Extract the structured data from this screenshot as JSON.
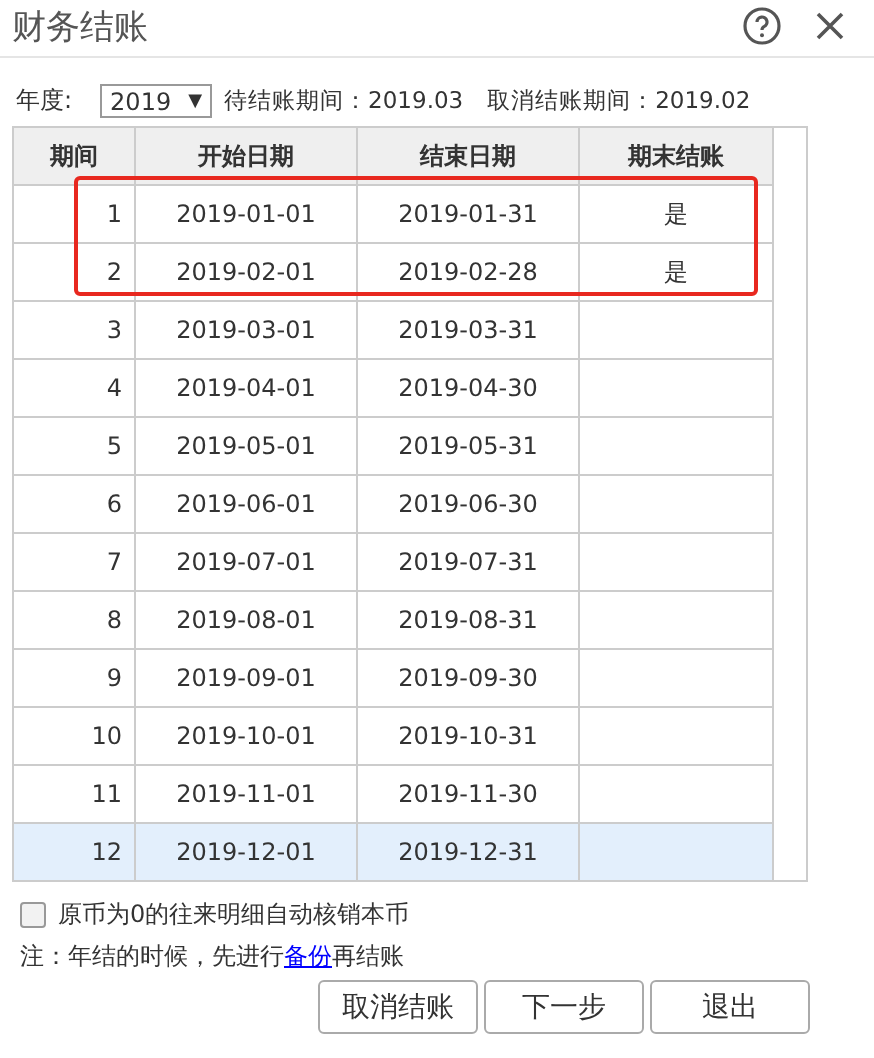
{
  "window": {
    "title": "财务结账"
  },
  "toolbar": {
    "year_label": "年度:",
    "year": "2019",
    "year_caret": "▼",
    "pending_period": "待结账期间：2019.03",
    "cancel_period": "取消结账期间：2019.02"
  },
  "table": {
    "columns": [
      "期间",
      "开始日期",
      "结束日期",
      "期末结账"
    ],
    "rows": [
      {
        "period": "1",
        "start": "2019-01-01",
        "end": "2019-01-31",
        "closed": "是",
        "selected": false,
        "marked": true
      },
      {
        "period": "2",
        "start": "2019-02-01",
        "end": "2019-02-28",
        "closed": "是",
        "selected": false,
        "marked": true
      },
      {
        "period": "3",
        "start": "2019-03-01",
        "end": "2019-03-31",
        "selected": false,
        "marked": false
      },
      {
        "period": "4",
        "start": "2019-04-01",
        "end": "2019-04-30",
        "selected": false,
        "marked": false
      },
      {
        "period": "5",
        "start": "2019-05-01",
        "end": "2019-05-31",
        "selected": false,
        "marked": false
      },
      {
        "period": "6",
        "start": "2019-06-01",
        "end": "2019-06-30",
        "selected": false,
        "marked": false
      },
      {
        "period": "7",
        "start": "2019-07-01",
        "end": "2019-07-31",
        "selected": false,
        "marked": false
      },
      {
        "period": "8",
        "start": "2019-08-01",
        "end": "2019-08-31",
        "selected": false,
        "marked": false
      },
      {
        "period": "9",
        "start": "2019-09-01",
        "end": "2019-09-30",
        "selected": false,
        "marked": false
      },
      {
        "period": "10",
        "start": "2019-10-01",
        "end": "2019-10-31",
        "selected": false,
        "marked": false
      },
      {
        "period": "11",
        "start": "2019-11-01",
        "end": "2019-11-30",
        "selected": false,
        "marked": false
      },
      {
        "period": "12",
        "start": "2019-12-01",
        "end": "2019-12-31",
        "selected": true,
        "marked": false
      }
    ]
  },
  "option": {
    "label": "原币为0的往来明细自动核销本币",
    "checked": false
  },
  "note_parts": {
    "before": "注：年结的时候，先进行",
    "link": "备份",
    "after": "再结账"
  },
  "buttons": [
    "取消结账",
    "下一步",
    "退出"
  ]
}
